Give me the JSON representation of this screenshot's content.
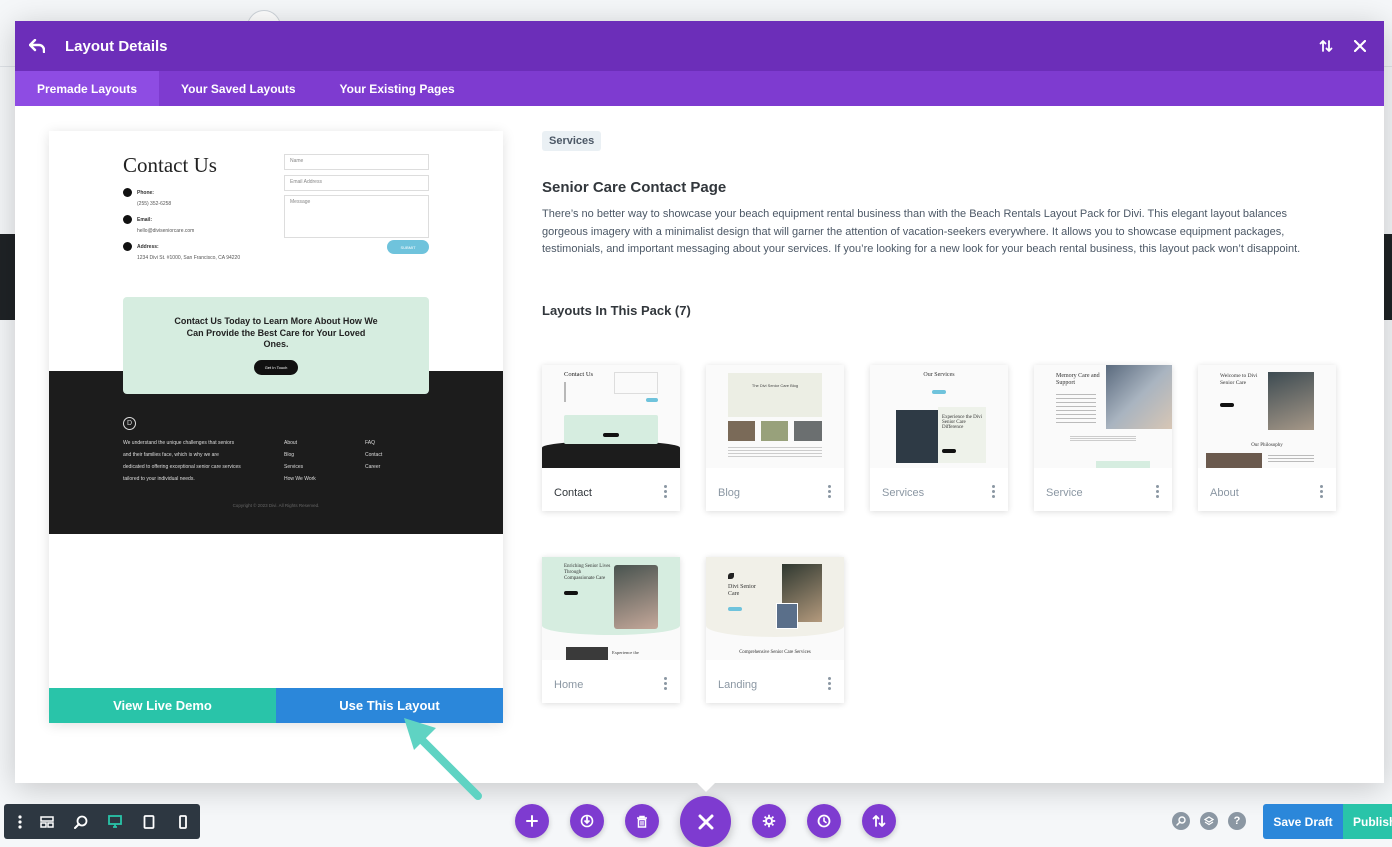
{
  "header": {
    "title": "Layout Details"
  },
  "tabs": [
    {
      "label": "Premade Layouts",
      "active": true
    },
    {
      "label": "Your Saved Layouts",
      "active": false
    },
    {
      "label": "Your Existing Pages",
      "active": false
    }
  ],
  "preview": {
    "title": "Contact Us",
    "phone_label": "Phone:",
    "phone_value": "(255) 352-6258",
    "email_label": "Email:",
    "email_value": "hello@diviseniorcare.com",
    "address_label": "Address:",
    "address_value": "1234 Divi St. #1000, San Francisco, CA 94220",
    "field_name": "Name",
    "field_email": "Email Address",
    "field_message": "Message",
    "submit": "SUBMIT",
    "cta_text": "Contact Us Today to Learn More About How We Can Provide the Best Care for Your Loved Ones.",
    "cta_button": "Get In Touch",
    "footer_about": "We understand the unique challenges that seniors and their families face, which is why we are dedicated to offering exceptional senior care services tailored to your individual needs.",
    "footer_links_1": [
      "About",
      "Blog",
      "Services",
      "How We Work"
    ],
    "footer_links_2": [
      "FAQ",
      "Contact",
      "Career"
    ],
    "copyright": "Copyright © 2023 Divi. All Rights Reserved.",
    "btn_demo": "View Live Demo",
    "btn_use": "Use This Layout"
  },
  "details": {
    "tag": "Services",
    "title": "Senior Care Contact Page",
    "description": "There’s no better way to showcase your beach equipment rental business than with the Beach Rentals Layout Pack for Divi. This elegant layout balances gorgeous imagery with a minimalist design that will garner the attention of vacation-seekers everywhere. It allows you to showcase equipment packages, testimonials, and important messaging about your services. If you’re looking for a new look for your beach rental business, this layout pack won’t disappoint.",
    "pack_title": "Layouts In This Pack (7)"
  },
  "pack_layouts": [
    {
      "label": "Contact",
      "active": true
    },
    {
      "label": "Blog",
      "active": false
    },
    {
      "label": "Services",
      "active": false
    },
    {
      "label": "Service",
      "active": false
    },
    {
      "label": "About",
      "active": false
    },
    {
      "label": "Home",
      "active": false
    },
    {
      "label": "Landing",
      "active": false
    }
  ],
  "thumb_text": {
    "contact": "Contact Us",
    "blog": "The Divi Senior Care Blog",
    "services": "Our Services",
    "service": "Memory Care and Support",
    "about": "Welcome to Divi Senior Care",
    "about_sub": "Our Philosophy",
    "home": "Enriching Senior Lives Through Compassionate Care",
    "landing": "Divi Senior Care",
    "landing_sub": "Comprehensive Senior Care Services"
  },
  "footer_bar": {
    "save_draft": "Save Draft",
    "publish": "Publish"
  },
  "colors": {
    "purple_header": "#6c2eb9",
    "purple_tabs": "#7e3bd0",
    "teal": "#29c4a9",
    "blue": "#2b87da"
  }
}
